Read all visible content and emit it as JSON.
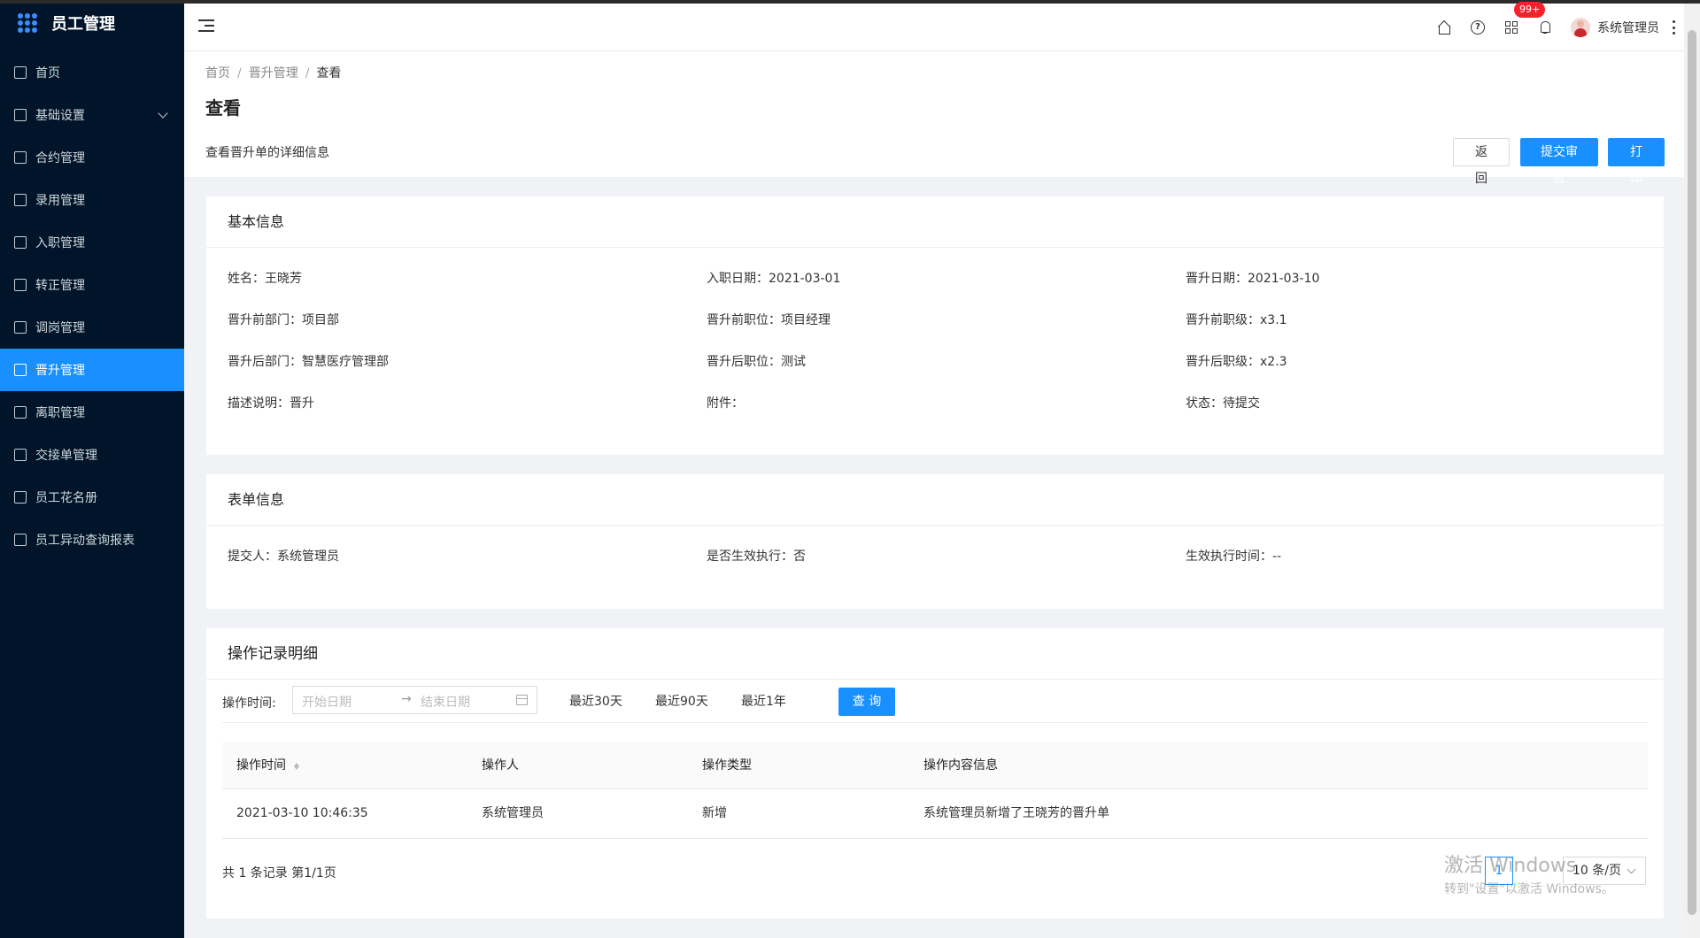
{
  "app": {
    "title": "员工管理"
  },
  "sidebar": {
    "items": [
      {
        "label": "首页"
      },
      {
        "label": "基础设置"
      },
      {
        "label": "合约管理"
      },
      {
        "label": "录用管理"
      },
      {
        "label": "入职管理"
      },
      {
        "label": "转正管理"
      },
      {
        "label": "调岗管理"
      },
      {
        "label": "晋升管理"
      },
      {
        "label": "离职管理"
      },
      {
        "label": "交接单管理"
      },
      {
        "label": "员工花名册"
      },
      {
        "label": "员工异动查询报表"
      }
    ],
    "active": "晋升管理"
  },
  "header": {
    "badge": "99+",
    "username": "系统管理员",
    "help_glyph": "?"
  },
  "breadcrumb": {
    "items": [
      "首页",
      "晋升管理",
      "查看"
    ]
  },
  "page": {
    "title": "查看",
    "desc": "查看晋升单的详细信息",
    "buttons": {
      "back": "返 回",
      "submit": "提交审批",
      "print": "打 印"
    }
  },
  "basic": {
    "title": "基本信息",
    "fields": [
      "姓名：王晓芳",
      "入职日期：2021-03-01",
      "晋升日期：2021-03-10",
      "晋升前部门：项目部",
      "晋升前职位：项目经理",
      "晋升前职级：x3.1",
      "晋升后部门：智慧医疗管理部",
      "晋升后职位：测试",
      "晋升后职级：x2.3",
      "描述说明：晋升",
      "附件：",
      "状态：待提交"
    ]
  },
  "form": {
    "title": "表单信息",
    "fields": [
      "提交人：系统管理员",
      "是否生效执行：否",
      "生效执行时间：--"
    ]
  },
  "ops": {
    "title": "操作记录明细",
    "filter_label": "操作时间:",
    "start_placeholder": "开始日期",
    "end_placeholder": "结束日期",
    "range_arrow": "→",
    "quick": [
      "最近30天",
      "最近90天",
      "最近1年"
    ],
    "query": "查 询",
    "columns": [
      "操作时间",
      "操作人",
      "操作类型",
      "操作内容信息"
    ],
    "rows": [
      [
        "2021-03-10 10:46:35",
        "系统管理员",
        "新增",
        "系统管理员新增了王晓芳的晋升单"
      ]
    ],
    "total": "共 1 条记录 第1/1页",
    "page": "1",
    "page_size": "10 条/页"
  },
  "watermark": {
    "line1": "激活 Windows",
    "line2": "转到\"设置\"以激活 Windows。"
  },
  "colors": {
    "primary": "#1890ff",
    "sidebar_bg": "#001529",
    "badge": "#f5222d"
  }
}
